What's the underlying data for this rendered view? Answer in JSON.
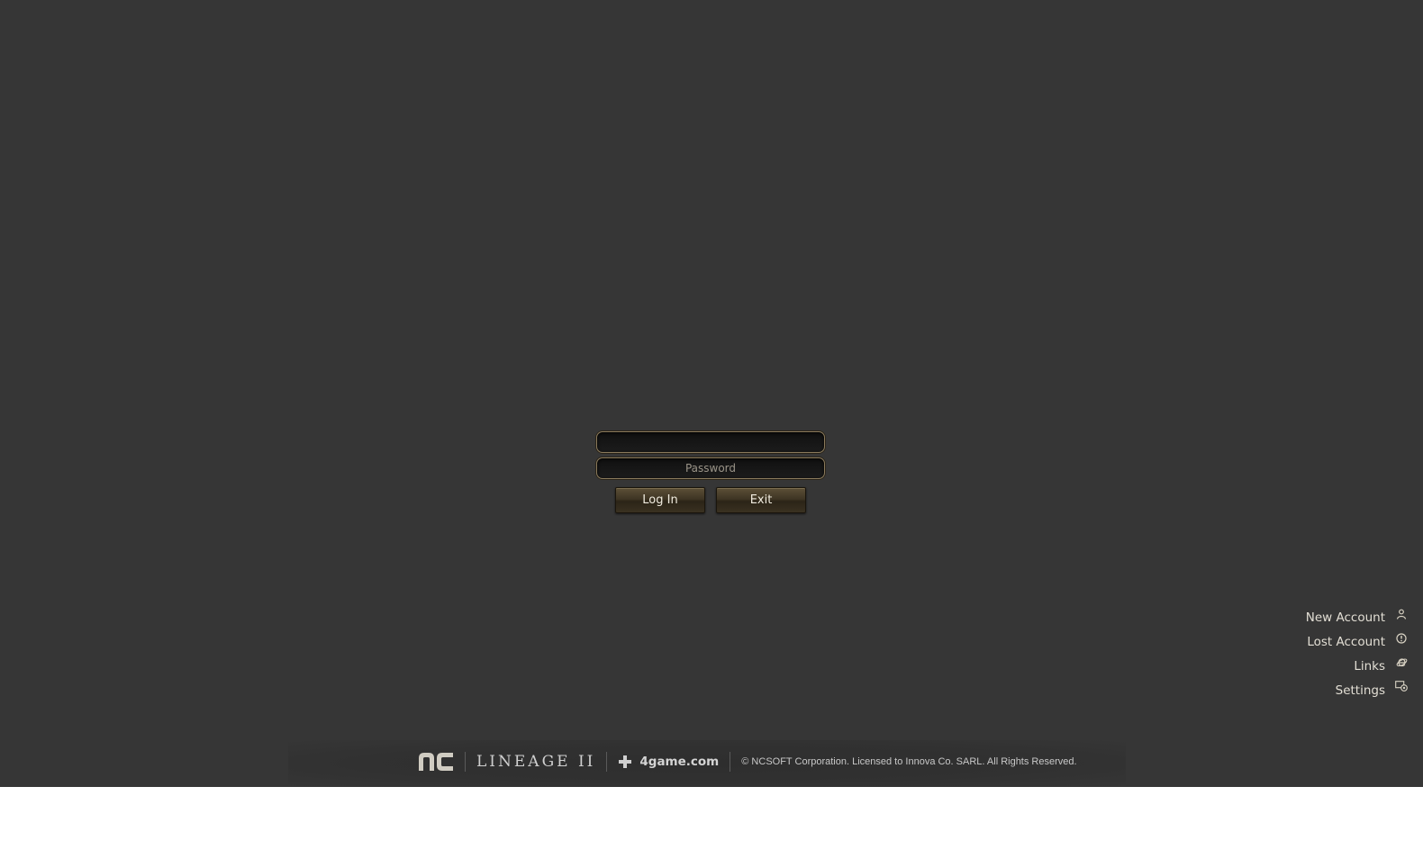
{
  "login": {
    "username_value": "",
    "username_placeholder": "",
    "password_placeholder": "Password",
    "login_label": "Log In",
    "exit_label": "Exit"
  },
  "menu": {
    "items": [
      {
        "label": "New Account",
        "icon": "user-icon"
      },
      {
        "label": "Lost Account",
        "icon": "info-icon"
      },
      {
        "label": "Links",
        "icon": "internet-explorer-icon"
      },
      {
        "label": "Settings",
        "icon": "settings-icon"
      }
    ]
  },
  "footer": {
    "nc_logo": "nc",
    "lineage_logo": "LINEAGE II",
    "game_site": "4game.com",
    "copyright": "© NCSOFT Corporation. Licensed to Innova Co. SARL. All Rights Reserved."
  },
  "colors": {
    "background": "#363636",
    "accent_gold": "#8a7a5c",
    "text_light": "#e2ded4"
  }
}
